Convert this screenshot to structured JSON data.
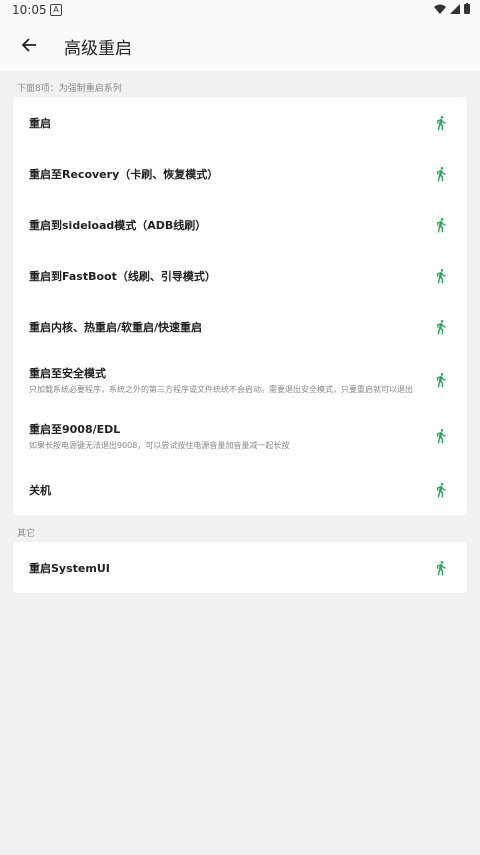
{
  "status": {
    "time": "10:05",
    "notif": "A"
  },
  "app": {
    "title": "高级重启"
  },
  "sections": [
    {
      "label": "下面8项：为强制重启系列",
      "items": [
        {
          "label": "重启"
        },
        {
          "label": "重启至Recovery（卡刷、恢复模式）"
        },
        {
          "label": "重启到sideload模式（ADB线刷）"
        },
        {
          "label": "重启到FastBoot（线刷、引导模式）"
        },
        {
          "label": "重启内核、热重启/软重启/快速重启"
        },
        {
          "label": "重启至安全模式",
          "desc": "只加载系统必要程序，系统之外的第三方程序或文件统统不会启动。需要退出安全模式，只要重启就可以退出"
        },
        {
          "label": "重启至9008/EDL",
          "desc": "如果长按电源键无法退出9008，可以尝试按住电源音量加音量减一起长按"
        },
        {
          "label": "关机"
        }
      ]
    },
    {
      "label": "其它",
      "items": [
        {
          "label": "重启SystemUI"
        }
      ]
    }
  ],
  "colors": {
    "accent": "#2aa85e"
  },
  "icons": {
    "action": "running-icon",
    "back": "back-arrow-icon"
  }
}
